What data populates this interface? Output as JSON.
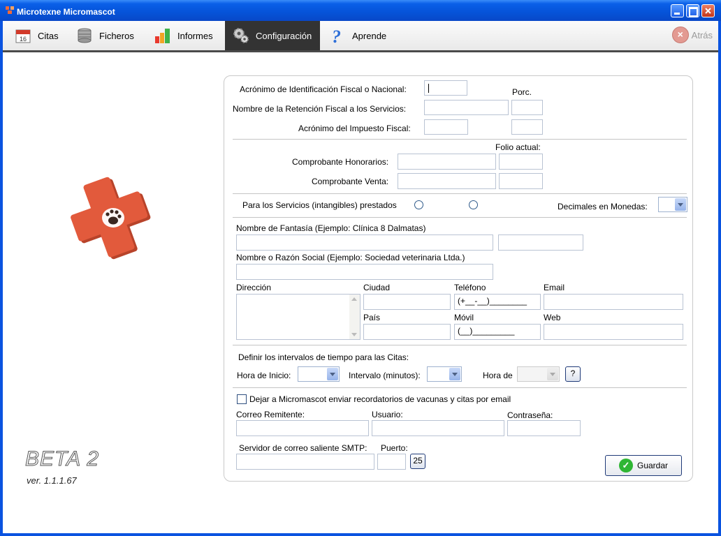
{
  "window": {
    "title": "Microtexne Micromascot"
  },
  "toolbar": {
    "citas": "Citas",
    "ficheros": "Ficheros",
    "informes": "Informes",
    "configuracion": "Configuración",
    "aprende": "Aprende",
    "atras": "Atrás"
  },
  "branding": {
    "beta": "BETA 2",
    "version": "ver. 1.1.1.67"
  },
  "fiscal": {
    "acronym_label": "Acrónimo de Identificación Fiscal o Nacional:",
    "acronym_value": "",
    "porc_label": "Porc.",
    "retention_label": "Nombre de la Retención Fiscal a los Servicios:",
    "tax_label": "Acrónimo del Impuesto Fiscal:"
  },
  "vouchers": {
    "folio_label": "Folio actual:",
    "honorarios_label": "Comprobante Honorarios:",
    "venta_label": "Comprobante Venta:"
  },
  "services": {
    "label": "Para los Servicios (intangibles) prestados",
    "decimals_label": "Decimales en Monedas:"
  },
  "clinic": {
    "fantasy_label": "Nombre de Fantasía (Ejemplo: Clínica 8 Dalmatas)",
    "legal_label": "Nombre o Razón Social (Ejemplo: Sociedad veterinaria Ltda.)",
    "address_label": "Dirección",
    "city_label": "Ciudad",
    "phone_label": "Teléfono",
    "phone_mask": "(+__-__)________",
    "email_label": "Email",
    "country_label": "País",
    "mobile_label": "Móvil",
    "mobile_mask": "(__)_________",
    "web_label": "Web"
  },
  "intervals": {
    "title": "Definir los intervalos de tiempo para las Citas:",
    "start_label": "Hora de Inicio:",
    "interval_label": "Intervalo (minutos):",
    "end_label": "Hora de",
    "help": "?"
  },
  "email": {
    "checkbox_label": "Dejar a Micromascot enviar recordatorios de vacunas y citas por email",
    "sender_label": "Correo Remitente:",
    "user_label": "Usuario:",
    "password_label": "Contraseña:",
    "smtp_label": "Servidor de correo saliente SMTP:",
    "port_label": "Puerto:",
    "port_default": "25"
  },
  "actions": {
    "save": "Guardar"
  },
  "colors": {
    "titlebar": "#0553d8",
    "active_tab": "#333333",
    "save_icon": "#2fb634"
  }
}
